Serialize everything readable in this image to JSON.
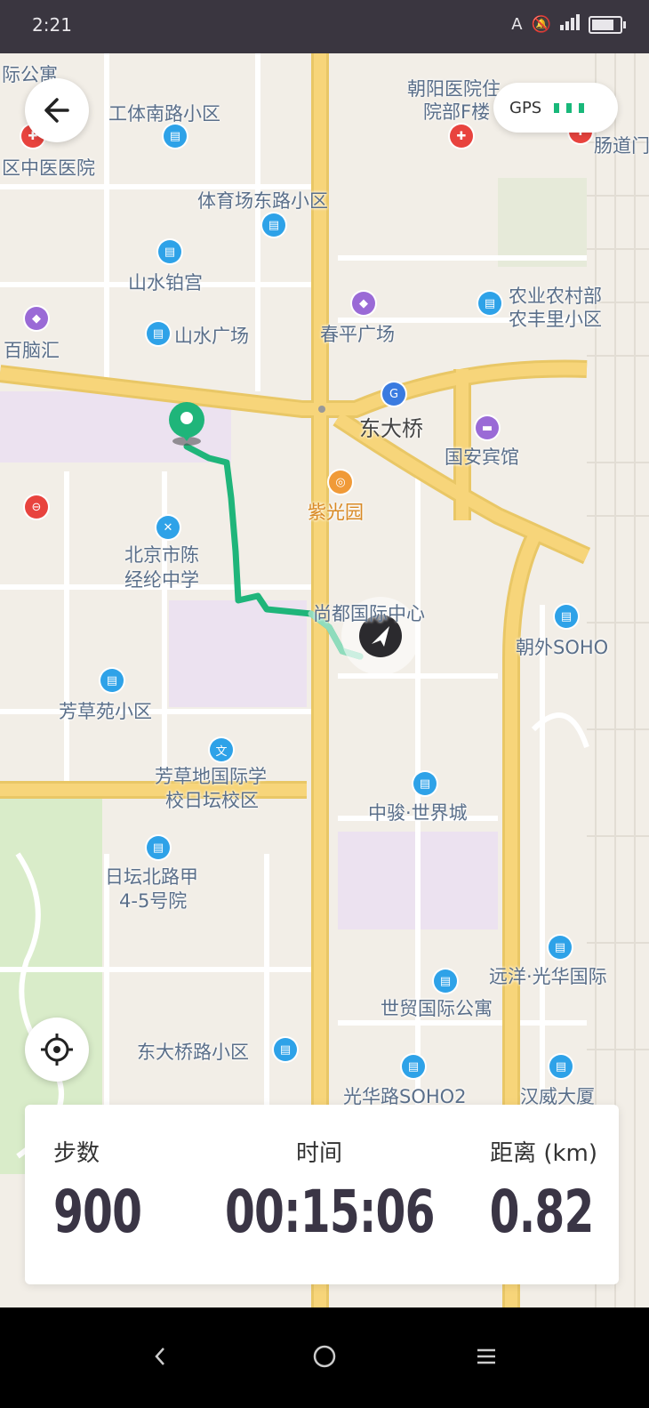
{
  "status_bar": {
    "time": "2:21",
    "sim": "A"
  },
  "gps": {
    "label": "GPS",
    "signal_bars": 3
  },
  "map_labels": [
    {
      "key": "l1",
      "text": "际公寓"
    },
    {
      "key": "l2",
      "text": "工体南路小区"
    },
    {
      "key": "l3",
      "text": "朝阳医院住"
    },
    {
      "key": "l4",
      "text": "院部F楼"
    },
    {
      "key": "l5",
      "text": "区中医医院"
    },
    {
      "key": "l6",
      "text": "肠道门"
    },
    {
      "key": "l7",
      "text": "体育场东路小区"
    },
    {
      "key": "l8",
      "text": "山水铂宫"
    },
    {
      "key": "l9",
      "text": "农业农村部"
    },
    {
      "key": "l10",
      "text": "农丰里小区"
    },
    {
      "key": "l11",
      "text": "百脑汇"
    },
    {
      "key": "l12",
      "text": "山水广场"
    },
    {
      "key": "l13",
      "text": "春平广场"
    },
    {
      "key": "l14",
      "text": "东大桥"
    },
    {
      "key": "l15",
      "text": "国安宾馆"
    },
    {
      "key": "l16",
      "text": "紫光园"
    },
    {
      "key": "l17",
      "text": "北京市陈"
    },
    {
      "key": "l18",
      "text": "经纶中学"
    },
    {
      "key": "l19",
      "text": "尚都国际中心"
    },
    {
      "key": "l20",
      "text": "朝外SOHO"
    },
    {
      "key": "l21",
      "text": "芳草苑小区"
    },
    {
      "key": "l22",
      "text": "芳草地国际学"
    },
    {
      "key": "l23",
      "text": "校日坛校区"
    },
    {
      "key": "l24",
      "text": "中骏·世界城"
    },
    {
      "key": "l25",
      "text": "日坛北路甲"
    },
    {
      "key": "l26",
      "text": "4-5号院"
    },
    {
      "key": "l27",
      "text": "远洋·光华国际"
    },
    {
      "key": "l28",
      "text": "世贸国际公寓"
    },
    {
      "key": "l29",
      "text": "东大桥路小区"
    },
    {
      "key": "l30",
      "text": "光华路SOHO2"
    },
    {
      "key": "l31",
      "text": "汉威大厦"
    }
  ],
  "stats": {
    "steps_label": "步数",
    "steps_value": "900",
    "time_label": "时间",
    "time_value": "00:15:06",
    "distance_label": "距离 (km)",
    "distance_value": "0.82"
  },
  "colors": {
    "route": "#1fb57a",
    "road_major": "#f7d57a",
    "status_bar": "#3a3640"
  }
}
